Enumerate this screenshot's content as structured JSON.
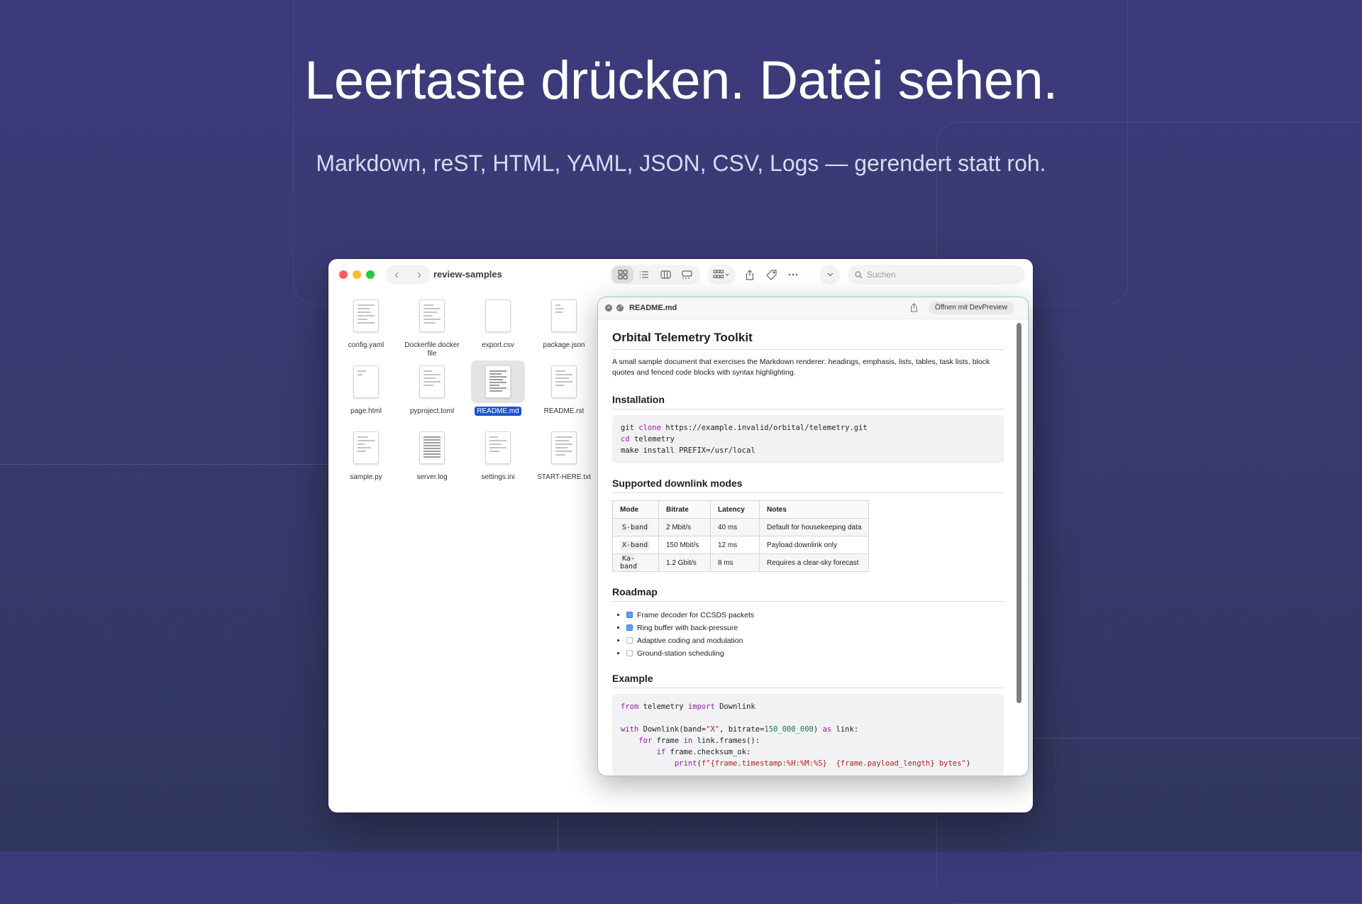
{
  "hero": {
    "headline": "Leertaste drücken. Datei sehen.",
    "subline": "Markdown, reST, HTML, YAML, JSON, CSV, Logs — gerendert statt roh."
  },
  "finder": {
    "window_title": "review-samples",
    "search_placeholder": "Suchen",
    "nav": {
      "back": "‹",
      "forward": "›"
    },
    "files": [
      {
        "name": "config.yaml",
        "selected": false
      },
      {
        "name": "Dockerfile.docker file",
        "selected": false
      },
      {
        "name": "export.csv",
        "selected": false
      },
      {
        "name": "package.json",
        "selected": false
      },
      {
        "name": "page.html",
        "selected": false
      },
      {
        "name": "pyproject.toml",
        "selected": false
      },
      {
        "name": "README.md",
        "selected": true
      },
      {
        "name": "README.rst",
        "selected": false
      },
      {
        "name": "sample.py",
        "selected": false
      },
      {
        "name": "server.log",
        "selected": false
      },
      {
        "name": "settings.ini",
        "selected": false
      },
      {
        "name": "START-HERE.txt",
        "selected": false
      }
    ]
  },
  "quicklook": {
    "file_name": "README.md",
    "open_button": "Öffnen mit DevPreview",
    "doc": {
      "title": "Orbital Telemetry Toolkit",
      "intro": "A small sample document that exercises the Markdown renderer: headings, emphasis, lists, tables, task lists, block quotes and fenced code blocks with syntax highlighting.",
      "install_heading": "Installation",
      "install_code": [
        {
          "a": "git ",
          "kw": "clone",
          "b": " https://example.invalid/orbital/telemetry.git"
        },
        {
          "a": "",
          "kw": "cd",
          "b": " telemetry"
        },
        {
          "a": "make install PREFIX=/usr/local",
          "kw": "",
          "b": ""
        }
      ],
      "modes_heading": "Supported downlink modes",
      "table_headers": [
        "Mode",
        "Bitrate",
        "Latency",
        "Notes"
      ],
      "table_rows": [
        [
          "S-band",
          "2 Mbit/s",
          "40 ms",
          "Default for housekeeping data"
        ],
        [
          "X-band",
          "150 Mbit/s",
          "12 ms",
          "Payload downlink only"
        ],
        [
          "Ka-band",
          "1.2 Gbit/s",
          "8 ms",
          "Requires a clear-sky forecast"
        ]
      ],
      "roadmap_heading": "Roadmap",
      "tasks": [
        {
          "label": "Frame decoder for CCSDS packets",
          "done": true
        },
        {
          "label": "Ring buffer with back-pressure",
          "done": true
        },
        {
          "label": "Adaptive coding and modulation",
          "done": false
        },
        {
          "label": "Ground-station scheduling",
          "done": false
        }
      ],
      "example_heading": "Example",
      "example_code": {
        "l1_from": "from",
        "l1_mod": " telemetry ",
        "l1_import": "import",
        "l1_name": " Downlink",
        "l3_with": "with",
        "l3_call": " Downlink(band=",
        "l3_band": "\"X\"",
        "l3_mid": ", bitrate=",
        "l3_rate": "150_000_000",
        "l3_end": ") ",
        "l3_as": "as",
        "l3_link": " link:",
        "l4_for": "for",
        "l4_mid": " frame ",
        "l4_in": "in",
        "l4_end": " link.frames():",
        "l5_if": "if",
        "l5_end": " frame.checksum_ok:",
        "l6_print": "print",
        "l6_open": "(",
        "l6_str": "f\"{frame.timestamp:%H:%M:%S}  {frame.payload_length} bytes\"",
        "l6_close": ")"
      }
    }
  },
  "colors": {
    "background": "#3b3a78",
    "selection": "#1d54d0",
    "keyword": "#9b14b5",
    "string": "#b5201c",
    "number": "#137a4a",
    "checkbox_on": "#5b9ef5"
  }
}
